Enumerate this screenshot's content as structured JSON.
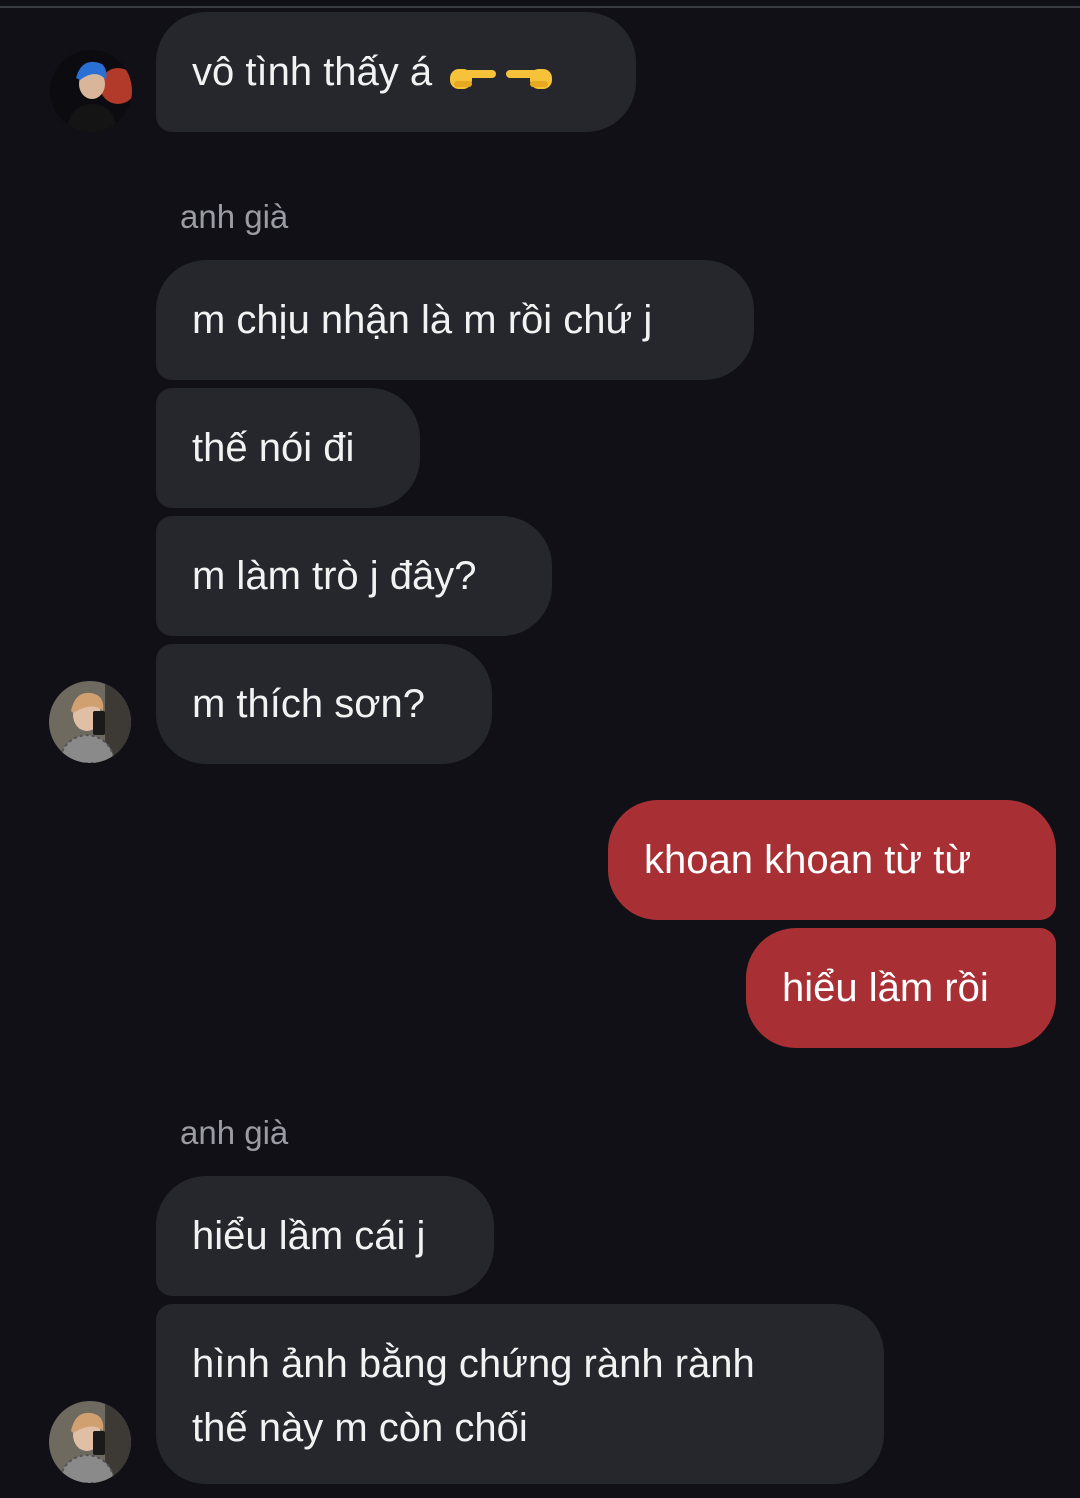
{
  "messages": [
    {
      "text": "vô tình thấy á",
      "emoji": "👉👈"
    },
    {
      "sender": "anh già"
    },
    {
      "text": "m chịu nhận là m rồi chứ j"
    },
    {
      "text": "thế nói đi"
    },
    {
      "text": "m làm trò j đây?"
    },
    {
      "text": "m thích sơn?"
    },
    {
      "text": "khoan khoan từ từ"
    },
    {
      "text": "hiểu lầm rồi"
    },
    {
      "sender": "anh già"
    },
    {
      "text": "hiểu lầm cái j"
    },
    {
      "line1": "hình ảnh bằng chứng rành rành",
      "line2": "thế này m còn chối"
    }
  ],
  "colors": {
    "background": "#101016",
    "incoming_bubble": "#25272d",
    "outgoing_bubble": "#a83034",
    "sender_text": "#9a9ba3"
  }
}
